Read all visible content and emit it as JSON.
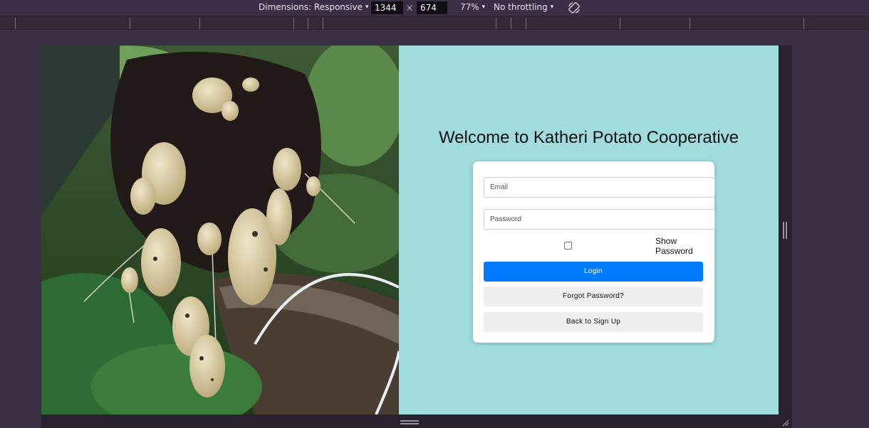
{
  "devtools": {
    "dimensions_label": "Dimensions: Responsive",
    "width_value": "1344",
    "times_symbol": "×",
    "height_value": "674",
    "zoom_label": "77%",
    "throttling_label": "No throttling",
    "caret": "▾",
    "rotate_icon": "rotate-icon"
  },
  "page": {
    "title": "Welcome to Katheri Potato Cooperative",
    "background_color": "#a0dcdc",
    "photo_alt": "Freshly harvested potatoes on roots",
    "form": {
      "email_placeholder": "Email",
      "password_placeholder": "Password",
      "show_password_label": "Show Password",
      "show_password_checked": false,
      "login_label": "Login",
      "forgot_label": "Forgot Password?",
      "back_label": "Back to Sign Up"
    },
    "colors": {
      "primary_button": "#007bff",
      "secondary_button": "#efefef"
    }
  }
}
